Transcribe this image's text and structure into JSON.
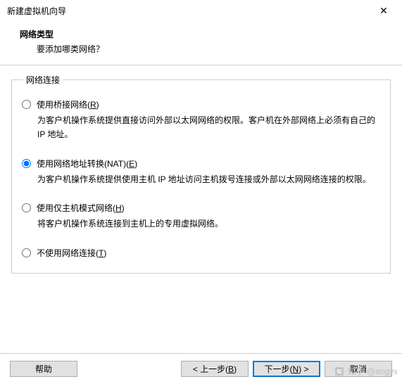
{
  "window": {
    "title": "新建虚拟机向导",
    "close": "✕"
  },
  "header": {
    "heading": "网络类型",
    "subheading": "要添加哪类网络？"
  },
  "group": {
    "legend": "网络连接",
    "options": [
      {
        "label_pre": "使用桥接网络(",
        "mnemonic": "R",
        "label_post": ")",
        "desc": "为客户机操作系统提供直接访问外部以太网网络的权限。客户机在外部网络上必须有自己的 IP 地址。",
        "selected": false
      },
      {
        "label_pre": "使用网络地址转换(NAT)(",
        "mnemonic": "E",
        "label_post": ")",
        "desc": "为客户机操作系统提供使用主机 IP 地址访问主机拨号连接或外部以太网网络连接的权限。",
        "selected": true
      },
      {
        "label_pre": "使用仅主机模式网络(",
        "mnemonic": "H",
        "label_post": ")",
        "desc": "将客户机操作系统连接到主机上的专用虚拟网络。",
        "selected": false
      },
      {
        "label_pre": "不使用网络连接(",
        "mnemonic": "T",
        "label_post": ")",
        "desc": "",
        "selected": false
      }
    ]
  },
  "footer": {
    "help": "帮助",
    "back_pre": "< 上一步(",
    "back_mn": "B",
    "back_post": ")",
    "next_pre": "下一步(",
    "next_mn": "N",
    "next_post": ") >",
    "cancel": "取消"
  },
  "watermark": "知乎 @angyx"
}
